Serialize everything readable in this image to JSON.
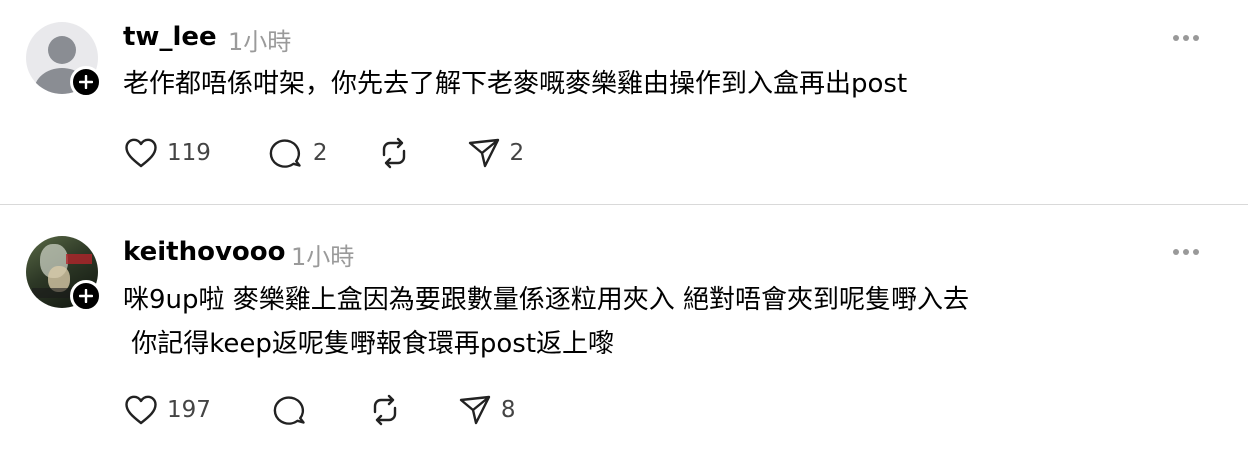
{
  "posts": [
    {
      "username": "tw_lee",
      "timestamp": "1小時",
      "avatar": "default-avatar-icon",
      "text": "老作都唔係咁架，你先去了解下老麥嘅麥樂雞由操作到入盒再出post",
      "likes": "119",
      "replies": "2",
      "reposts": "",
      "shares": "2"
    },
    {
      "username": "keithovooo",
      "timestamp": "1小時",
      "avatar": "user-photo",
      "text": "咪9up啦 麥樂雞上盒因為要跟數量￼係逐粒用夾入 ￼￼絕對唔會夾到呢隻嘢入去\n￼ 你記得keep返呢隻嘢報食環再post返上嚟",
      "likes": "197",
      "replies": "",
      "reposts": "",
      "shares": "8"
    }
  ],
  "icons": {
    "like": "heart-icon",
    "reply": "comment-bubble-icon",
    "repost": "repost-arrows-icon",
    "share": "send-icon",
    "more": "more-dots-icon",
    "follow": "plus-icon"
  },
  "colors": {
    "text": "#000000",
    "muted": "#9a9a9a",
    "icon": "#222222",
    "divider": "#d9d9d9"
  }
}
